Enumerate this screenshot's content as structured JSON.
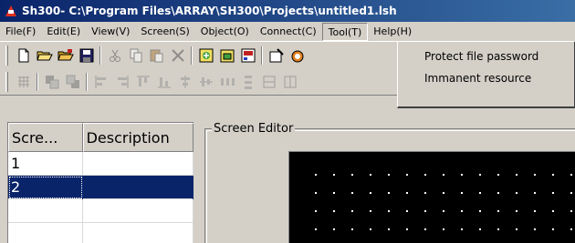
{
  "window": {
    "title": "Sh300- C:\\Program Files\\ARRAY\\SH300\\Projects\\untitled1.lsh"
  },
  "menubar": {
    "items": [
      {
        "label": "File(F)"
      },
      {
        "label": "Edit(E)"
      },
      {
        "label": "View(V)"
      },
      {
        "label": "Screen(S)"
      },
      {
        "label": "Object(O)"
      },
      {
        "label": "Connect(C)"
      },
      {
        "label": "Tool(T)",
        "active": true
      },
      {
        "label": "Help(H)"
      }
    ]
  },
  "tool_menu": {
    "items": [
      {
        "label": "Protect file password"
      },
      {
        "label": "Immanent resource"
      }
    ]
  },
  "toolbar1": {
    "icons": [
      "new-file-icon",
      "open-folder-icon",
      "open-project-icon",
      "save-icon",
      "cut-icon",
      "copy-icon",
      "paste-icon",
      "delete-icon",
      "new-screen-icon",
      "open-screen-icon",
      "screen-properties-icon",
      "settings-icon",
      "compile-icon"
    ]
  },
  "toolbar2": {
    "icons": [
      "grid-icon",
      "bring-front-icon",
      "send-back-icon",
      "align-left-icon",
      "align-right-icon",
      "align-top-icon",
      "align-bottom-icon",
      "center-horizontal-icon",
      "center-vertical-icon",
      "space-horizontal-icon",
      "space-vertical-icon",
      "same-width-icon",
      "same-height-icon"
    ]
  },
  "screen_list": {
    "columns": [
      "Scre...",
      "Description"
    ],
    "rows": [
      {
        "screen": "1",
        "description": ""
      },
      {
        "screen": "2",
        "description": "",
        "selected": true
      },
      {
        "screen": "",
        "description": ""
      },
      {
        "screen": "",
        "description": ""
      }
    ]
  },
  "editor": {
    "title": "Screen Editor"
  },
  "colors": {
    "titlebar_start": "#0a246a",
    "titlebar_end": "#3a6ea5",
    "face": "#d4d0c8",
    "selection": "#0a246a",
    "canvas": "#000000",
    "grid_dot": "#ffffff"
  }
}
